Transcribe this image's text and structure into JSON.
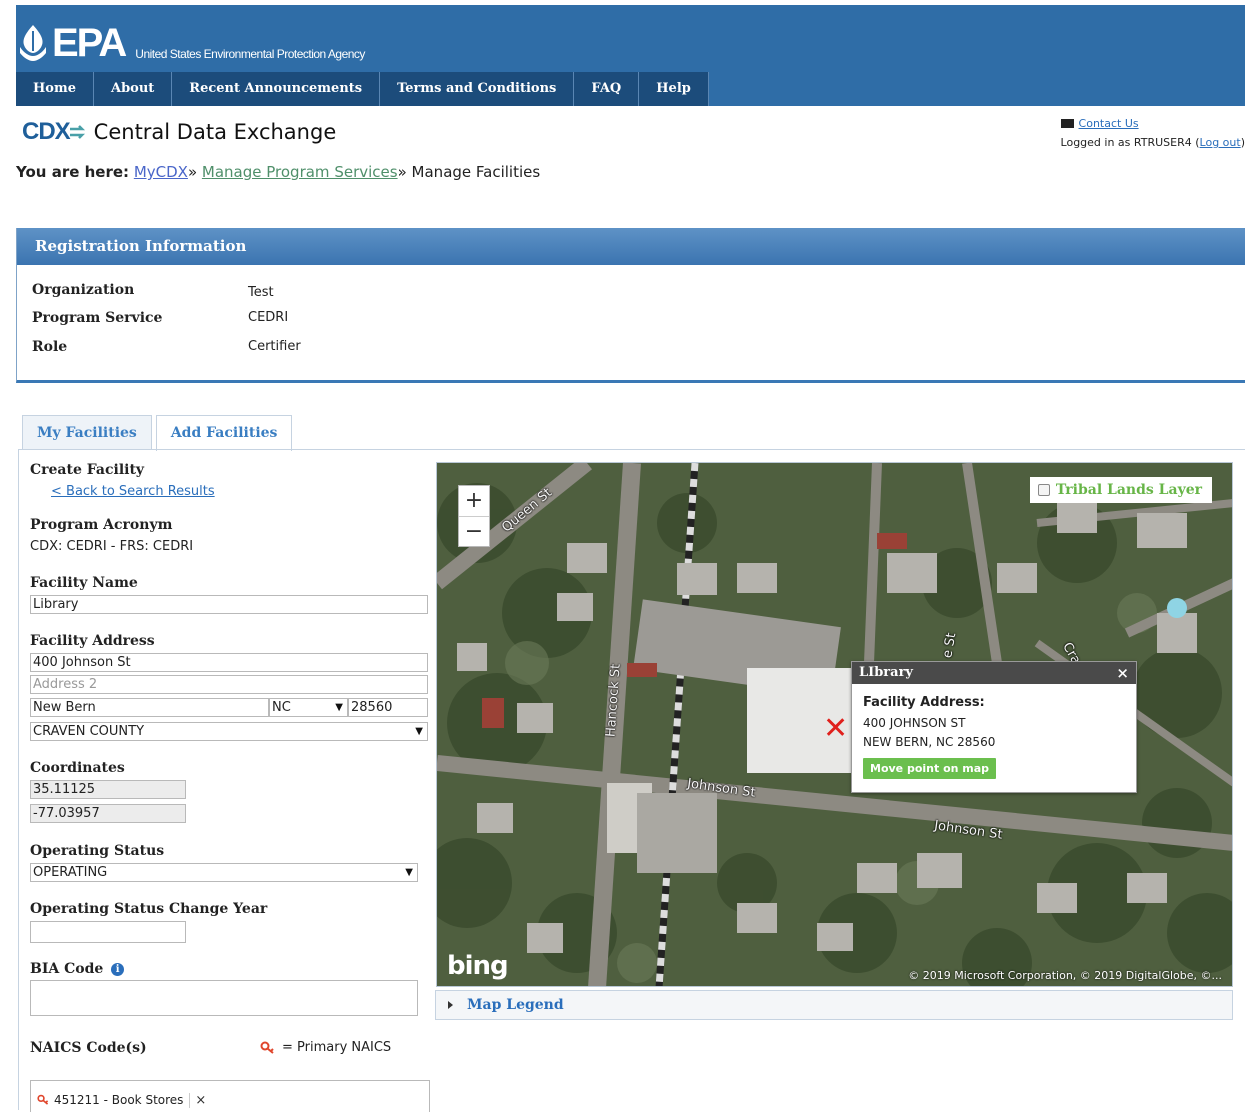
{
  "agency": {
    "logo_text": "EPA",
    "full_name": "United States Environmental Protection Agency"
  },
  "nav": {
    "items": [
      "Home",
      "About",
      "Recent Announcements",
      "Terms and Conditions",
      "FAQ",
      "Help"
    ]
  },
  "app": {
    "logo_text": "CDX",
    "title": "Central Data Exchange"
  },
  "user": {
    "contact_label": "Contact Us",
    "logged_in_prefix": "Logged in as RTRUSER4",
    "logout_label": "Log out"
  },
  "breadcrumb": {
    "label": "You are here:",
    "links": [
      "MyCDX",
      "Manage Program Services"
    ],
    "separator": "»",
    "current": "Manage Facilities"
  },
  "registration": {
    "header": "Registration Information",
    "rows": [
      {
        "key": "Organization",
        "value": "Test"
      },
      {
        "key": "Program Service",
        "value": "CEDRI"
      },
      {
        "key": "Role",
        "value": "Certifier"
      }
    ]
  },
  "tabs": [
    {
      "label": "My Facilities",
      "active": false
    },
    {
      "label": "Add Facilities",
      "active": true
    }
  ],
  "form": {
    "section_title": "Create Facility",
    "back_link": "< Back to Search Results",
    "program_acronym": {
      "label": "Program Acronym",
      "value": "CDX: CEDRI - FRS: CEDRI"
    },
    "facility_name": {
      "label": "Facility Name",
      "value": "Library"
    },
    "facility_address": {
      "label": "Facility Address",
      "line1": "400 Johnson St",
      "line2_placeholder": "Address 2",
      "city": "New Bern",
      "state": "NC",
      "zip": "28560",
      "county": "CRAVEN COUNTY"
    },
    "coordinates": {
      "label": "Coordinates",
      "lat": "35.11125",
      "lon": "-77.03957"
    },
    "operating_status": {
      "label": "Operating Status",
      "value": "OPERATING"
    },
    "status_change_year": {
      "label": "Operating Status Change Year",
      "value": ""
    },
    "bia_code": {
      "label": "BIA Code",
      "info_icon": "i",
      "value": ""
    },
    "naics": {
      "label": "NAICS Code(s)",
      "key_text": "= Primary NAICS",
      "chips": [
        {
          "text": "451211 - Book Stores",
          "remove": "×"
        }
      ]
    }
  },
  "map": {
    "zoom_in": "+",
    "zoom_out": "−",
    "layer_toggle": "Tribal Lands Layer",
    "popup": {
      "title": "LIbrary",
      "close": "×",
      "address_label": "Facility Address:",
      "address_lines": [
        "400 JOHNSON ST",
        "NEW BERN, NC 28560"
      ],
      "move_button": "Move point on map"
    },
    "marker": "✕",
    "street_labels": [
      "Queen St",
      "Hancock St",
      "Johnson St",
      "Johnson St",
      "e St",
      "Cra"
    ],
    "provider": "bing",
    "copyright": "© 2019 Microsoft Corporation, © 2019 DigitalGlobe, ©...",
    "legend_label": "Map Legend"
  },
  "colors": {
    "epa_blue": "#2f6da7",
    "nav_dark": "#1c4c7b",
    "link_blue": "#2a6ebb",
    "move_green": "#6bbf4e",
    "tribal_green": "#67b547",
    "marker_red": "#e0201c"
  }
}
